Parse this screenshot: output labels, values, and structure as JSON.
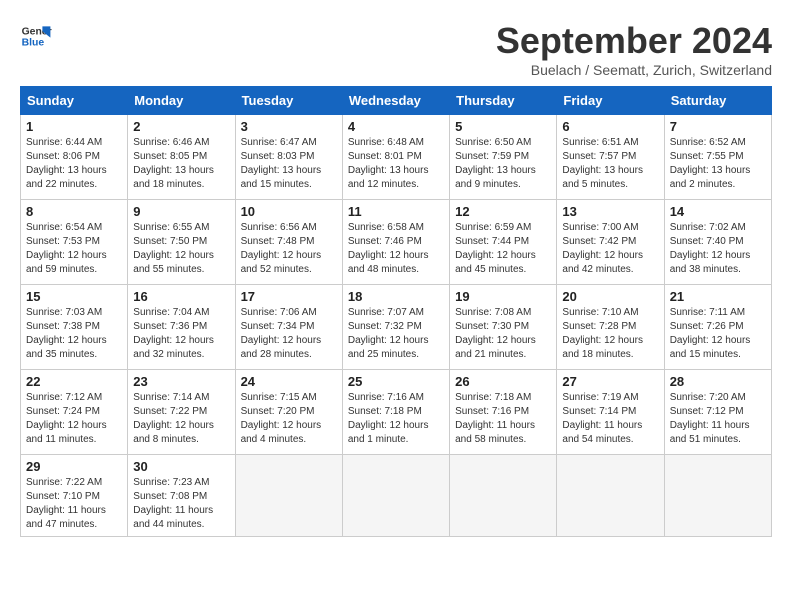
{
  "header": {
    "logo_line1": "General",
    "logo_line2": "Blue",
    "month_title": "September 2024",
    "subtitle": "Buelach / Seematt, Zurich, Switzerland"
  },
  "weekdays": [
    "Sunday",
    "Monday",
    "Tuesday",
    "Wednesday",
    "Thursday",
    "Friday",
    "Saturday"
  ],
  "weeks": [
    [
      {
        "day": "1",
        "info": "Sunrise: 6:44 AM\nSunset: 8:06 PM\nDaylight: 13 hours\nand 22 minutes."
      },
      {
        "day": "2",
        "info": "Sunrise: 6:46 AM\nSunset: 8:05 PM\nDaylight: 13 hours\nand 18 minutes."
      },
      {
        "day": "3",
        "info": "Sunrise: 6:47 AM\nSunset: 8:03 PM\nDaylight: 13 hours\nand 15 minutes."
      },
      {
        "day": "4",
        "info": "Sunrise: 6:48 AM\nSunset: 8:01 PM\nDaylight: 13 hours\nand 12 minutes."
      },
      {
        "day": "5",
        "info": "Sunrise: 6:50 AM\nSunset: 7:59 PM\nDaylight: 13 hours\nand 9 minutes."
      },
      {
        "day": "6",
        "info": "Sunrise: 6:51 AM\nSunset: 7:57 PM\nDaylight: 13 hours\nand 5 minutes."
      },
      {
        "day": "7",
        "info": "Sunrise: 6:52 AM\nSunset: 7:55 PM\nDaylight: 13 hours\nand 2 minutes."
      }
    ],
    [
      {
        "day": "8",
        "info": "Sunrise: 6:54 AM\nSunset: 7:53 PM\nDaylight: 12 hours\nand 59 minutes."
      },
      {
        "day": "9",
        "info": "Sunrise: 6:55 AM\nSunset: 7:50 PM\nDaylight: 12 hours\nand 55 minutes."
      },
      {
        "day": "10",
        "info": "Sunrise: 6:56 AM\nSunset: 7:48 PM\nDaylight: 12 hours\nand 52 minutes."
      },
      {
        "day": "11",
        "info": "Sunrise: 6:58 AM\nSunset: 7:46 PM\nDaylight: 12 hours\nand 48 minutes."
      },
      {
        "day": "12",
        "info": "Sunrise: 6:59 AM\nSunset: 7:44 PM\nDaylight: 12 hours\nand 45 minutes."
      },
      {
        "day": "13",
        "info": "Sunrise: 7:00 AM\nSunset: 7:42 PM\nDaylight: 12 hours\nand 42 minutes."
      },
      {
        "day": "14",
        "info": "Sunrise: 7:02 AM\nSunset: 7:40 PM\nDaylight: 12 hours\nand 38 minutes."
      }
    ],
    [
      {
        "day": "15",
        "info": "Sunrise: 7:03 AM\nSunset: 7:38 PM\nDaylight: 12 hours\nand 35 minutes."
      },
      {
        "day": "16",
        "info": "Sunrise: 7:04 AM\nSunset: 7:36 PM\nDaylight: 12 hours\nand 32 minutes."
      },
      {
        "day": "17",
        "info": "Sunrise: 7:06 AM\nSunset: 7:34 PM\nDaylight: 12 hours\nand 28 minutes."
      },
      {
        "day": "18",
        "info": "Sunrise: 7:07 AM\nSunset: 7:32 PM\nDaylight: 12 hours\nand 25 minutes."
      },
      {
        "day": "19",
        "info": "Sunrise: 7:08 AM\nSunset: 7:30 PM\nDaylight: 12 hours\nand 21 minutes."
      },
      {
        "day": "20",
        "info": "Sunrise: 7:10 AM\nSunset: 7:28 PM\nDaylight: 12 hours\nand 18 minutes."
      },
      {
        "day": "21",
        "info": "Sunrise: 7:11 AM\nSunset: 7:26 PM\nDaylight: 12 hours\nand 15 minutes."
      }
    ],
    [
      {
        "day": "22",
        "info": "Sunrise: 7:12 AM\nSunset: 7:24 PM\nDaylight: 12 hours\nand 11 minutes."
      },
      {
        "day": "23",
        "info": "Sunrise: 7:14 AM\nSunset: 7:22 PM\nDaylight: 12 hours\nand 8 minutes."
      },
      {
        "day": "24",
        "info": "Sunrise: 7:15 AM\nSunset: 7:20 PM\nDaylight: 12 hours\nand 4 minutes."
      },
      {
        "day": "25",
        "info": "Sunrise: 7:16 AM\nSunset: 7:18 PM\nDaylight: 12 hours\nand 1 minute."
      },
      {
        "day": "26",
        "info": "Sunrise: 7:18 AM\nSunset: 7:16 PM\nDaylight: 11 hours\nand 58 minutes."
      },
      {
        "day": "27",
        "info": "Sunrise: 7:19 AM\nSunset: 7:14 PM\nDaylight: 11 hours\nand 54 minutes."
      },
      {
        "day": "28",
        "info": "Sunrise: 7:20 AM\nSunset: 7:12 PM\nDaylight: 11 hours\nand 51 minutes."
      }
    ],
    [
      {
        "day": "29",
        "info": "Sunrise: 7:22 AM\nSunset: 7:10 PM\nDaylight: 11 hours\nand 47 minutes."
      },
      {
        "day": "30",
        "info": "Sunrise: 7:23 AM\nSunset: 7:08 PM\nDaylight: 11 hours\nand 44 minutes."
      },
      {
        "day": "",
        "info": ""
      },
      {
        "day": "",
        "info": ""
      },
      {
        "day": "",
        "info": ""
      },
      {
        "day": "",
        "info": ""
      },
      {
        "day": "",
        "info": ""
      }
    ]
  ]
}
